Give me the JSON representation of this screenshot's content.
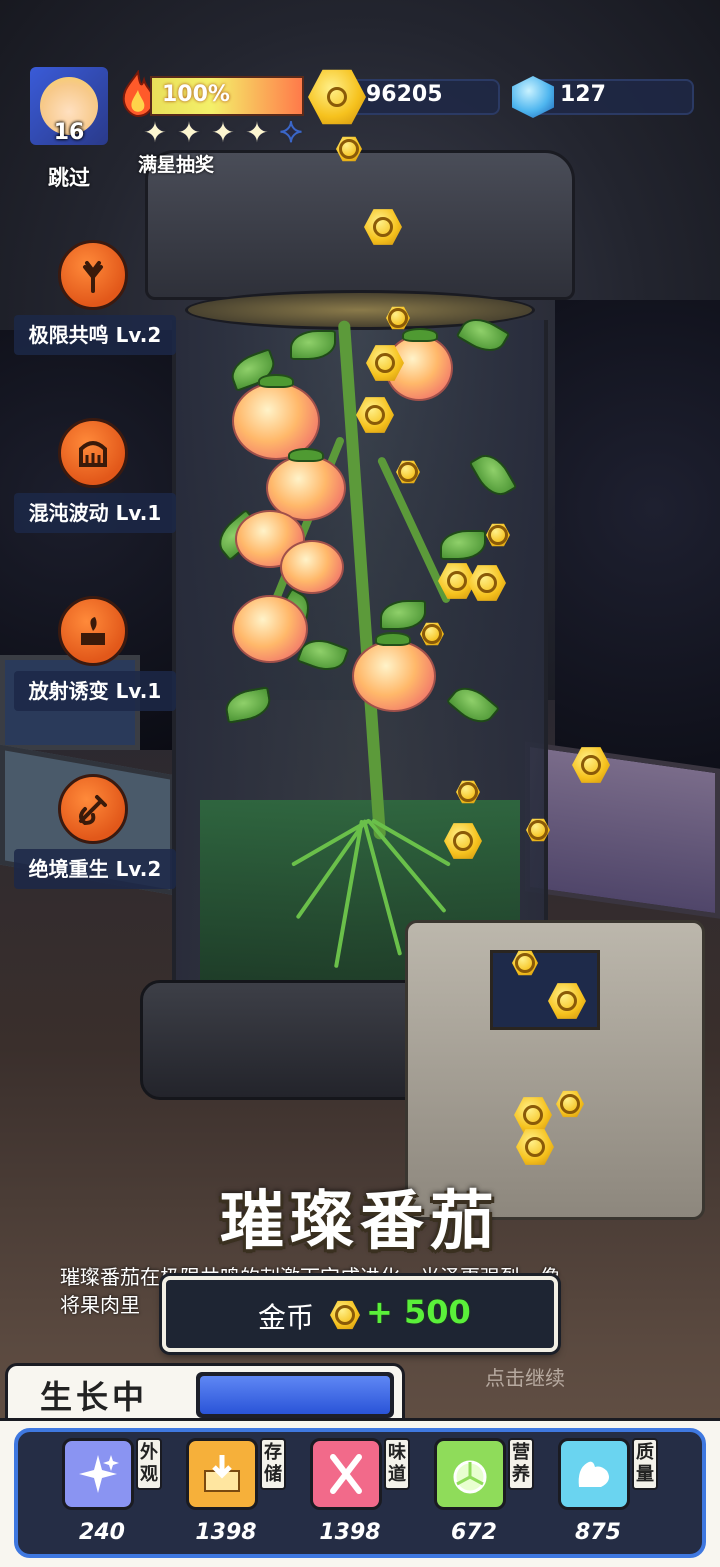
{
  "player": {
    "level": "16",
    "skip_label": "跳过"
  },
  "energy": {
    "percent_text": "100%",
    "fill_fraction": 1.0,
    "stars_filled": 4,
    "stars_total": 5,
    "stars_label": "满星抽奖"
  },
  "resources": {
    "coins": "96205",
    "gems": "127"
  },
  "skills": [
    {
      "label": "极限共鸣 Lv.2",
      "icon": "resonance-icon"
    },
    {
      "label": "混沌波动 Lv.1",
      "icon": "chaos-wave-icon"
    },
    {
      "label": "放射诱变 Lv.1",
      "icon": "radiation-mutation-icon"
    },
    {
      "label": "绝境重生 Lv.2",
      "icon": "rebirth-icon"
    }
  ],
  "result": {
    "title": "璀璨番茄",
    "description_line1": "璀璨番茄在极限共鸣的刺激下完成进化，光泽更强烈，像",
    "description_line2": "将果肉里",
    "reward_label": "金币",
    "reward_value": "+ 500",
    "tap_continue": "点击继续"
  },
  "growth": {
    "label": "生长中",
    "progress_fraction": 1.0
  },
  "stats": [
    {
      "tag": "外观",
      "value": "240",
      "icon": "sparkle-icon",
      "color": "#8a94f2"
    },
    {
      "tag": "存储",
      "value": "1398",
      "icon": "storage-box-icon",
      "color": "#f6b03a"
    },
    {
      "tag": "味道",
      "value": "1398",
      "icon": "fork-knife-icon",
      "color": "#f26a8a"
    },
    {
      "tag": "营养",
      "value": "672",
      "icon": "lemon-icon",
      "color": "#8fdc5a"
    },
    {
      "tag": "质量",
      "value": "875",
      "icon": "muscle-icon",
      "color": "#6ad4f0"
    }
  ],
  "colors": {
    "accent_blue": "#3f78e0",
    "reward_green": "#5af03a",
    "skill_orange": "#e2581a"
  }
}
